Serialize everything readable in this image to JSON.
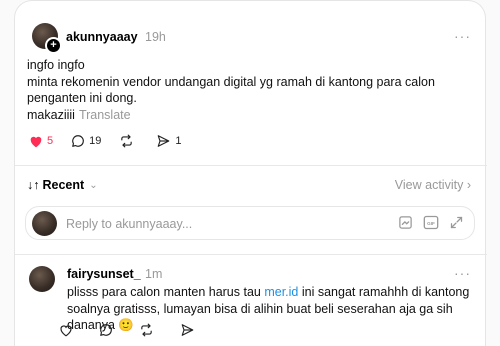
{
  "post": {
    "username": "akunnyaaay",
    "time": "19h",
    "more": "···",
    "lines": [
      "ingfo ingfo",
      "minta rekomenin vendor undangan digital yg ramah di kantong para calon penganten ini dong.",
      "makaziiii"
    ],
    "translate": "Translate",
    "likes": "5",
    "comments": "19",
    "shares": "1",
    "liked_color": "#ff2d55"
  },
  "sort": {
    "label": "Recent",
    "view_activity": "View activity"
  },
  "reply": {
    "placeholder": "Reply to akunnyaaay..."
  },
  "comment": {
    "username": "fairysunset_",
    "time": "1m",
    "more": "···",
    "text_before": "plisss para calon manten harus tau ",
    "link": "mer.id",
    "text_after": " ini sangat ramahhh di kantong soalnya gratisss, lumayan bisa di alihin buat beli seserahan aja ga sih dananya 🙂"
  }
}
